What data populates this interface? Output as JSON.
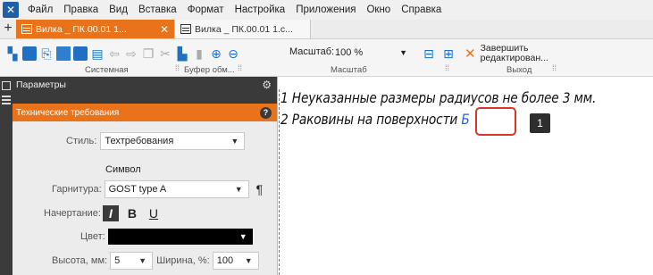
{
  "menubar": {
    "items": [
      "Файл",
      "Правка",
      "Вид",
      "Вставка",
      "Формат",
      "Настройка",
      "Приложения",
      "Окно",
      "Справка"
    ]
  },
  "tabs": [
    {
      "label": "Вилка _ ПК.00.01 1...",
      "active": true
    },
    {
      "label": "Вилка _ ПК.00.01 1.с...",
      "active": false
    }
  ],
  "toolbar": {
    "zoom_label": "Масштаб:",
    "zoom_value": "100 %",
    "finish_label_line1": "Завершить",
    "finish_label_line2": "редактирован...",
    "groups": [
      "Системная",
      "Буфер обм...",
      "Масштаб",
      "Выход"
    ]
  },
  "panel": {
    "title": "Параметры",
    "section": "Технические требования",
    "style_label": "Стиль:",
    "style_value": "Техтребования",
    "symbol_title": "Символ",
    "font_label": "Гарнитура:",
    "font_value": "GOST type A",
    "style_fmt_label": "Начертание:",
    "bold_label": "B",
    "italic_label": "I",
    "underline_label": "U",
    "color_label": "Цвет:",
    "height_label": "Высота, мм:",
    "height_value": "5",
    "width_label": "Ширина, %:",
    "width_value": "100"
  },
  "document": {
    "line1": "1 Неуказанные размеры радиусов не более 3 мм.",
    "line2_text": "2 Раковины на поверхности ",
    "line2_cursor_char": "Б"
  },
  "callout": {
    "number": "1"
  },
  "colors": {
    "accent": "#e8731a",
    "highlight": "#d9352b",
    "panel_dark": "#3a3a3a"
  }
}
